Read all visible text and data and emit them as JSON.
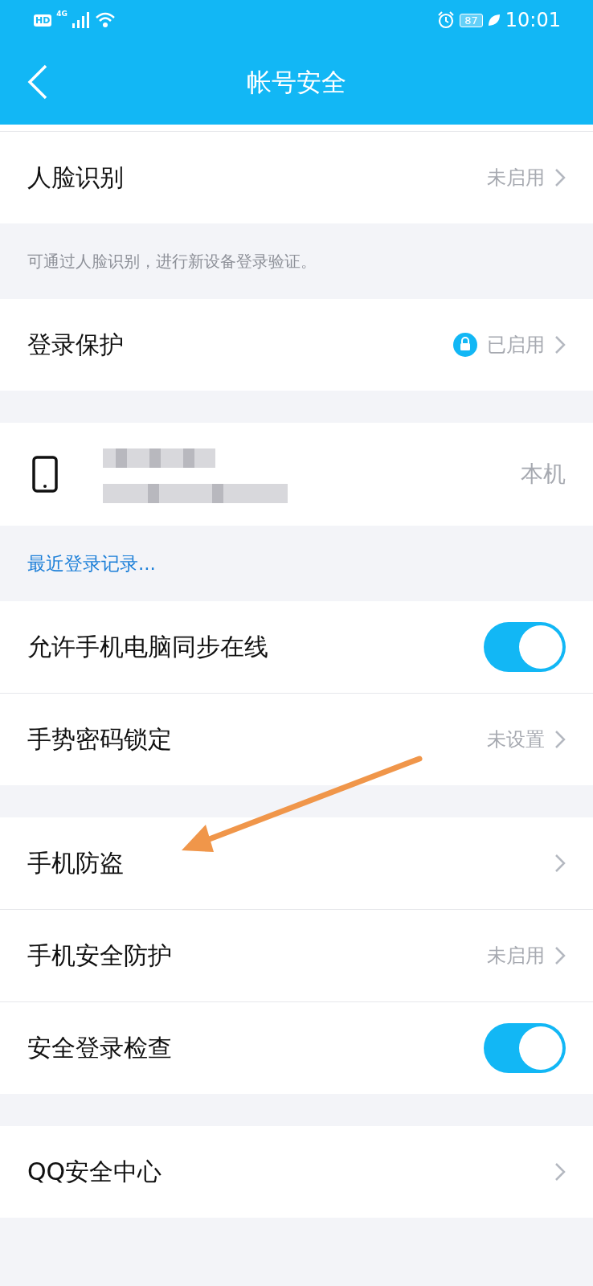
{
  "status_bar": {
    "hd": "HD",
    "network": "4G",
    "battery": "87",
    "time": "10:01"
  },
  "header": {
    "title": "帐号安全"
  },
  "sections": [
    {
      "rows": [
        {
          "kind": "link",
          "label": "人脸识别",
          "value": "未启用",
          "lock": false
        }
      ],
      "note": {
        "kind": "hint",
        "text": "可通过人脸识别，进行新设备登录验证。"
      }
    },
    {
      "rows": [
        {
          "kind": "link",
          "label": "登录保护",
          "value": "已启用",
          "lock": true
        }
      ]
    },
    {
      "rows": [
        {
          "kind": "device",
          "value": "本机"
        }
      ],
      "note": {
        "kind": "link",
        "text": "最近登录记录..."
      }
    },
    {
      "rows": [
        {
          "kind": "toggle",
          "label": "允许手机电脑同步在线",
          "on": true
        },
        {
          "kind": "link",
          "label": "手势密码锁定",
          "value": "未设置",
          "lock": false
        }
      ]
    },
    {
      "rows": [
        {
          "kind": "link",
          "label": "手机防盗",
          "lock": false
        },
        {
          "kind": "link",
          "label": "手机安全防护",
          "value": "未启用",
          "lock": false
        },
        {
          "kind": "toggle",
          "label": "安全登录检查",
          "on": true
        }
      ]
    },
    {
      "rows": [
        {
          "kind": "link",
          "label": "QQ安全中心",
          "lock": false
        }
      ]
    }
  ]
}
